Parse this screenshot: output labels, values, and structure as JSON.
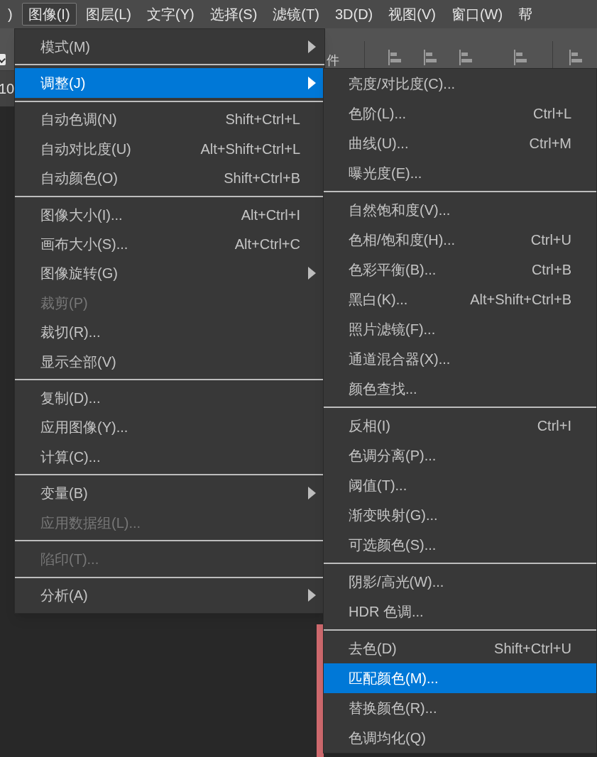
{
  "menubar": [
    {
      "label": ")",
      "selected": false
    },
    {
      "label": "图像(I)",
      "selected": true
    },
    {
      "label": "图层(L)",
      "selected": false
    },
    {
      "label": "文字(Y)",
      "selected": false
    },
    {
      "label": "选择(S)",
      "selected": false
    },
    {
      "label": "滤镜(T)",
      "selected": false
    },
    {
      "label": "3D(D)",
      "selected": false
    },
    {
      "label": "视图(V)",
      "selected": false
    },
    {
      "label": "窗口(W)",
      "selected": false
    },
    {
      "label": "帮",
      "selected": false
    }
  ],
  "toolbar": {
    "checkbox_checked": true,
    "label": "件",
    "zoom_field": "10"
  },
  "image_menu": [
    {
      "kind": "item",
      "label": "模式(M)",
      "submenu": true,
      "disabled": false,
      "selected": false
    },
    {
      "kind": "separator"
    },
    {
      "kind": "item",
      "label": "调整(J)",
      "submenu": true,
      "disabled": false,
      "selected": true
    },
    {
      "kind": "separator"
    },
    {
      "kind": "item",
      "label": "自动色调(N)",
      "shortcut": "Shift+Ctrl+L",
      "submenu": false,
      "disabled": false,
      "selected": false
    },
    {
      "kind": "item",
      "label": "自动对比度(U)",
      "shortcut": "Alt+Shift+Ctrl+L",
      "submenu": false,
      "disabled": false,
      "selected": false
    },
    {
      "kind": "item",
      "label": "自动颜色(O)",
      "shortcut": "Shift+Ctrl+B",
      "submenu": false,
      "disabled": false,
      "selected": false
    },
    {
      "kind": "separator"
    },
    {
      "kind": "item",
      "label": "图像大小(I)...",
      "shortcut": "Alt+Ctrl+I",
      "submenu": false,
      "disabled": false,
      "selected": false
    },
    {
      "kind": "item",
      "label": "画布大小(S)...",
      "shortcut": "Alt+Ctrl+C",
      "submenu": false,
      "disabled": false,
      "selected": false
    },
    {
      "kind": "item",
      "label": "图像旋转(G)",
      "submenu": true,
      "disabled": false,
      "selected": false
    },
    {
      "kind": "item",
      "label": "裁剪(P)",
      "submenu": false,
      "disabled": true,
      "selected": false
    },
    {
      "kind": "item",
      "label": "裁切(R)...",
      "submenu": false,
      "disabled": false,
      "selected": false
    },
    {
      "kind": "item",
      "label": "显示全部(V)",
      "submenu": false,
      "disabled": false,
      "selected": false
    },
    {
      "kind": "separator"
    },
    {
      "kind": "item",
      "label": "复制(D)...",
      "submenu": false,
      "disabled": false,
      "selected": false
    },
    {
      "kind": "item",
      "label": "应用图像(Y)...",
      "submenu": false,
      "disabled": false,
      "selected": false
    },
    {
      "kind": "item",
      "label": "计算(C)...",
      "submenu": false,
      "disabled": false,
      "selected": false
    },
    {
      "kind": "separator"
    },
    {
      "kind": "item",
      "label": "变量(B)",
      "submenu": true,
      "disabled": false,
      "selected": false
    },
    {
      "kind": "item",
      "label": "应用数据组(L)...",
      "submenu": false,
      "disabled": true,
      "selected": false
    },
    {
      "kind": "separator"
    },
    {
      "kind": "item",
      "label": "陷印(T)...",
      "submenu": false,
      "disabled": true,
      "selected": false
    },
    {
      "kind": "separator"
    },
    {
      "kind": "item",
      "label": "分析(A)",
      "submenu": true,
      "disabled": false,
      "selected": false
    }
  ],
  "adjust_submenu": [
    {
      "kind": "item",
      "label": "亮度/对比度(C)...",
      "submenu": false,
      "disabled": false,
      "selected": false
    },
    {
      "kind": "item",
      "label": "色阶(L)...",
      "shortcut": "Ctrl+L",
      "submenu": false,
      "disabled": false,
      "selected": false
    },
    {
      "kind": "item",
      "label": "曲线(U)...",
      "shortcut": "Ctrl+M",
      "submenu": false,
      "disabled": false,
      "selected": false
    },
    {
      "kind": "item",
      "label": "曝光度(E)...",
      "submenu": false,
      "disabled": false,
      "selected": false
    },
    {
      "kind": "separator"
    },
    {
      "kind": "item",
      "label": "自然饱和度(V)...",
      "submenu": false,
      "disabled": false,
      "selected": false
    },
    {
      "kind": "item",
      "label": "色相/饱和度(H)...",
      "shortcut": "Ctrl+U",
      "submenu": false,
      "disabled": false,
      "selected": false
    },
    {
      "kind": "item",
      "label": "色彩平衡(B)...",
      "shortcut": "Ctrl+B",
      "submenu": false,
      "disabled": false,
      "selected": false
    },
    {
      "kind": "item",
      "label": "黑白(K)...",
      "shortcut": "Alt+Shift+Ctrl+B",
      "submenu": false,
      "disabled": false,
      "selected": false
    },
    {
      "kind": "item",
      "label": "照片滤镜(F)...",
      "submenu": false,
      "disabled": false,
      "selected": false
    },
    {
      "kind": "item",
      "label": "通道混合器(X)...",
      "submenu": false,
      "disabled": false,
      "selected": false
    },
    {
      "kind": "item",
      "label": "颜色查找...",
      "submenu": false,
      "disabled": false,
      "selected": false
    },
    {
      "kind": "separator"
    },
    {
      "kind": "item",
      "label": "反相(I)",
      "shortcut": "Ctrl+I",
      "submenu": false,
      "disabled": false,
      "selected": false
    },
    {
      "kind": "item",
      "label": "色调分离(P)...",
      "submenu": false,
      "disabled": false,
      "selected": false
    },
    {
      "kind": "item",
      "label": "阈值(T)...",
      "submenu": false,
      "disabled": false,
      "selected": false
    },
    {
      "kind": "item",
      "label": "渐变映射(G)...",
      "submenu": false,
      "disabled": false,
      "selected": false
    },
    {
      "kind": "item",
      "label": "可选颜色(S)...",
      "submenu": false,
      "disabled": false,
      "selected": false
    },
    {
      "kind": "separator"
    },
    {
      "kind": "item",
      "label": "阴影/高光(W)...",
      "submenu": false,
      "disabled": false,
      "selected": false
    },
    {
      "kind": "item",
      "label": "HDR 色调...",
      "submenu": false,
      "disabled": false,
      "selected": false
    },
    {
      "kind": "separator"
    },
    {
      "kind": "item",
      "label": "去色(D)",
      "shortcut": "Shift+Ctrl+U",
      "submenu": false,
      "disabled": false,
      "selected": false
    },
    {
      "kind": "item",
      "label": "匹配颜色(M)...",
      "submenu": false,
      "disabled": false,
      "selected": true
    },
    {
      "kind": "item",
      "label": "替换颜色(R)...",
      "submenu": false,
      "disabled": false,
      "selected": false
    },
    {
      "kind": "item",
      "label": "色调均化(Q)",
      "submenu": false,
      "disabled": false,
      "selected": false
    }
  ]
}
